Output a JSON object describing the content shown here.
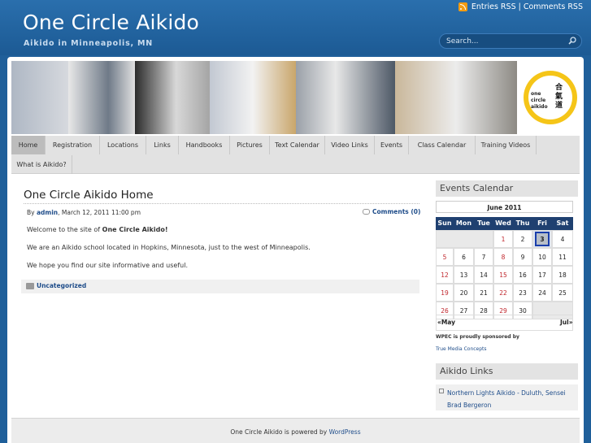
{
  "header": {
    "site_title": "One Circle Aikido",
    "site_description": "Aikido in Minneapolis, MN",
    "entries_rss": "Entries RSS",
    "separator": "|",
    "comments_rss": "Comments RSS",
    "search_placeholder": "Search..."
  },
  "banner": {
    "logo_text": "one circle aikido",
    "logo_kanji": "合氣道"
  },
  "nav": {
    "items": [
      "Home",
      "Registration",
      "Locations",
      "Links",
      "Handbooks",
      "Pictures",
      "Text Calendar",
      "Video Links",
      "Events",
      "Class Calendar",
      "Training Videos",
      "What is Aikido?"
    ],
    "active": "Home"
  },
  "post": {
    "title": "One Circle Aikido Home",
    "by": "By",
    "author": "admin",
    "date": ", March 12, 2011 11:00 pm",
    "comments": "Comments (0)",
    "p1_prefix": "Welcome to the site of ",
    "p1_bold": "One Circle Aikido!",
    "p2": "We are an Aikido school located in Hopkins, Minnesota, just to the west of Minneapolis.",
    "p3": "We hope you find our site informative and useful.",
    "category": "Uncategorized"
  },
  "sidebar": {
    "events_title": "Events Calendar",
    "calendar_caption": "June 2011",
    "weekdays": [
      "Sun",
      "Mon",
      "Tue",
      "Wed",
      "Thu",
      "Fri",
      "Sat"
    ],
    "today": "3",
    "prev": "«May",
    "next": "Jul»",
    "sponsor_line": "WPEC is proudly sponsored by",
    "sponsor_link": "True Media Concepts",
    "links_title": "Aikido Links",
    "link_item": "Northern Lights Aikido - Duluth, Sensei Brad Bergeron"
  },
  "footer": {
    "prefix": "One Circle Aikido is powered by ",
    "link": "WordPress"
  },
  "colors": {
    "background": "#1f5f9a",
    "calendar_header": "#1f4070",
    "link": "#1f4d8a",
    "event_day": "#c0262c"
  }
}
